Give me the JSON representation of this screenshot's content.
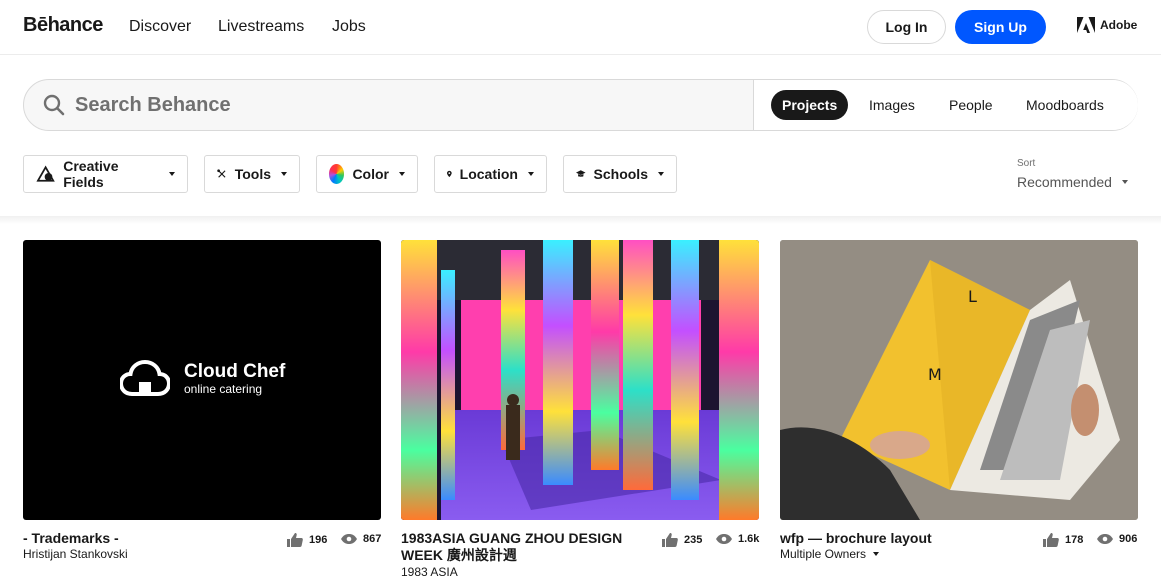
{
  "header": {
    "logo": "Bēhance",
    "nav": [
      "Discover",
      "Livestreams",
      "Jobs"
    ],
    "login_label": "Log In",
    "signup_label": "Sign Up",
    "adobe_label": "Adobe"
  },
  "search": {
    "placeholder": "Search Behance",
    "tabs": [
      "Projects",
      "Images",
      "People",
      "Moodboards"
    ],
    "active_tab": "Projects"
  },
  "filters": [
    "Creative Fields",
    "Tools",
    "Color",
    "Location",
    "Schools"
  ],
  "sort": {
    "label": "Sort",
    "value": "Recommended"
  },
  "projects": [
    {
      "thumb_text": "Cloud Chef",
      "thumb_subtext": "online catering",
      "title": "- Trademarks -",
      "owner": "Hristijan Stankovski",
      "likes": "196",
      "views": "867"
    },
    {
      "title": "1983ASIA GUANG ZHOU DESIGN WEEK 廣州設計週",
      "owner": "1983 ASIA",
      "likes": "235",
      "views": "1.6k"
    },
    {
      "thumb_letters": [
        "L",
        "M"
      ],
      "title": "wfp — brochure layout",
      "owner": "Multiple Owners",
      "likes": "178",
      "views": "906"
    }
  ],
  "colors": {
    "accent": "#0057ff",
    "text": "#191919",
    "muted": "#707070"
  }
}
